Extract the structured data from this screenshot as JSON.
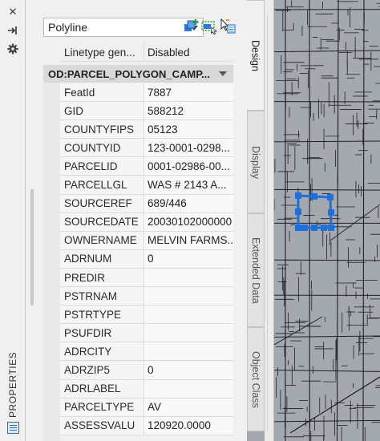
{
  "sidebar": {
    "title": "PROPERTIES",
    "icons": [
      "close-icon",
      "auto-hide-icon",
      "settings-icon"
    ]
  },
  "selector": {
    "value": "Polyline",
    "options": [
      "Polyline"
    ],
    "tools": [
      "quick-select-icon",
      "select-objects-icon",
      "toggle-pickadd-icon"
    ]
  },
  "linetype_row": {
    "name": "Linetype gen...",
    "value": "Disabled"
  },
  "category": {
    "label": "OD:PARCEL_POLYGON_CAMP..."
  },
  "properties": [
    {
      "name": "FeatId",
      "value": "7887"
    },
    {
      "name": "GID",
      "value": "588212"
    },
    {
      "name": "COUNTYFIPS",
      "value": "05123"
    },
    {
      "name": "COUNTYID",
      "value": "123-0001-0298..."
    },
    {
      "name": "PARCELID",
      "value": "0001-02986-00..."
    },
    {
      "name": "PARCELLGL",
      "value": "WAS #   2143 A..."
    },
    {
      "name": "SOURCEREF",
      "value": "689/446"
    },
    {
      "name": "SOURCEDATE",
      "value": "20030102000000"
    },
    {
      "name": "OWNERNAME",
      "value": "MELVIN FARMS..."
    },
    {
      "name": "ADRNUM",
      "value": "0"
    },
    {
      "name": "PREDIR",
      "value": ""
    },
    {
      "name": "PSTRNAM",
      "value": ""
    },
    {
      "name": "PSTRTYPE",
      "value": ""
    },
    {
      "name": "PSUFDIR",
      "value": ""
    },
    {
      "name": "ADRCITY",
      "value": ""
    },
    {
      "name": "ADRZIP5",
      "value": "0"
    },
    {
      "name": "ADRLABEL",
      "value": ""
    },
    {
      "name": "PARCELTYPE",
      "value": "AV"
    },
    {
      "name": "ASSESSVALU",
      "value": "120920.0000"
    }
  ],
  "tabs": {
    "design": "Design",
    "display": "Display",
    "extended": "Extended Data",
    "object_class": "Object Class"
  },
  "colors": {
    "selection": "#1e6fd9",
    "map_bg": "#a4a9af",
    "category_bg": "#d8d8d8"
  }
}
